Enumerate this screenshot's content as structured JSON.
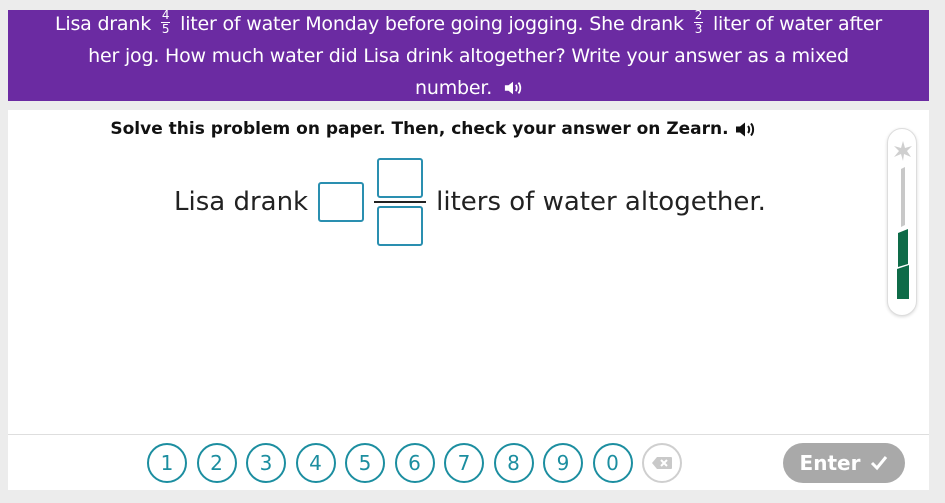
{
  "problem": {
    "part1": "Lisa drank",
    "frac1": {
      "num": "4",
      "den": "5"
    },
    "part2": "liter of water Monday before going jogging. She drank",
    "frac2": {
      "num": "2",
      "den": "3"
    },
    "part3": "liter of water after her jog. How much water did Lisa drink altogether? Write your answer as a mixed number."
  },
  "instruction": "Solve this problem on paper. Then, check your answer on Zearn.",
  "answer": {
    "prefix": "Lisa drank",
    "suffix": "liters of water altogether."
  },
  "keypad": {
    "keys": [
      "1",
      "2",
      "3",
      "4",
      "5",
      "6",
      "7",
      "8",
      "9",
      "0"
    ],
    "enter_label": "Enter"
  },
  "colors": {
    "banner": "#6b2ba2",
    "accent": "#1c8ea0",
    "meter_fill": "#0e6b48",
    "enter_disabled": "#a9a9a9"
  },
  "icons": {
    "speaker": "speaker-icon",
    "backspace": "backspace-icon",
    "check": "check-icon",
    "star": "star-icon"
  }
}
